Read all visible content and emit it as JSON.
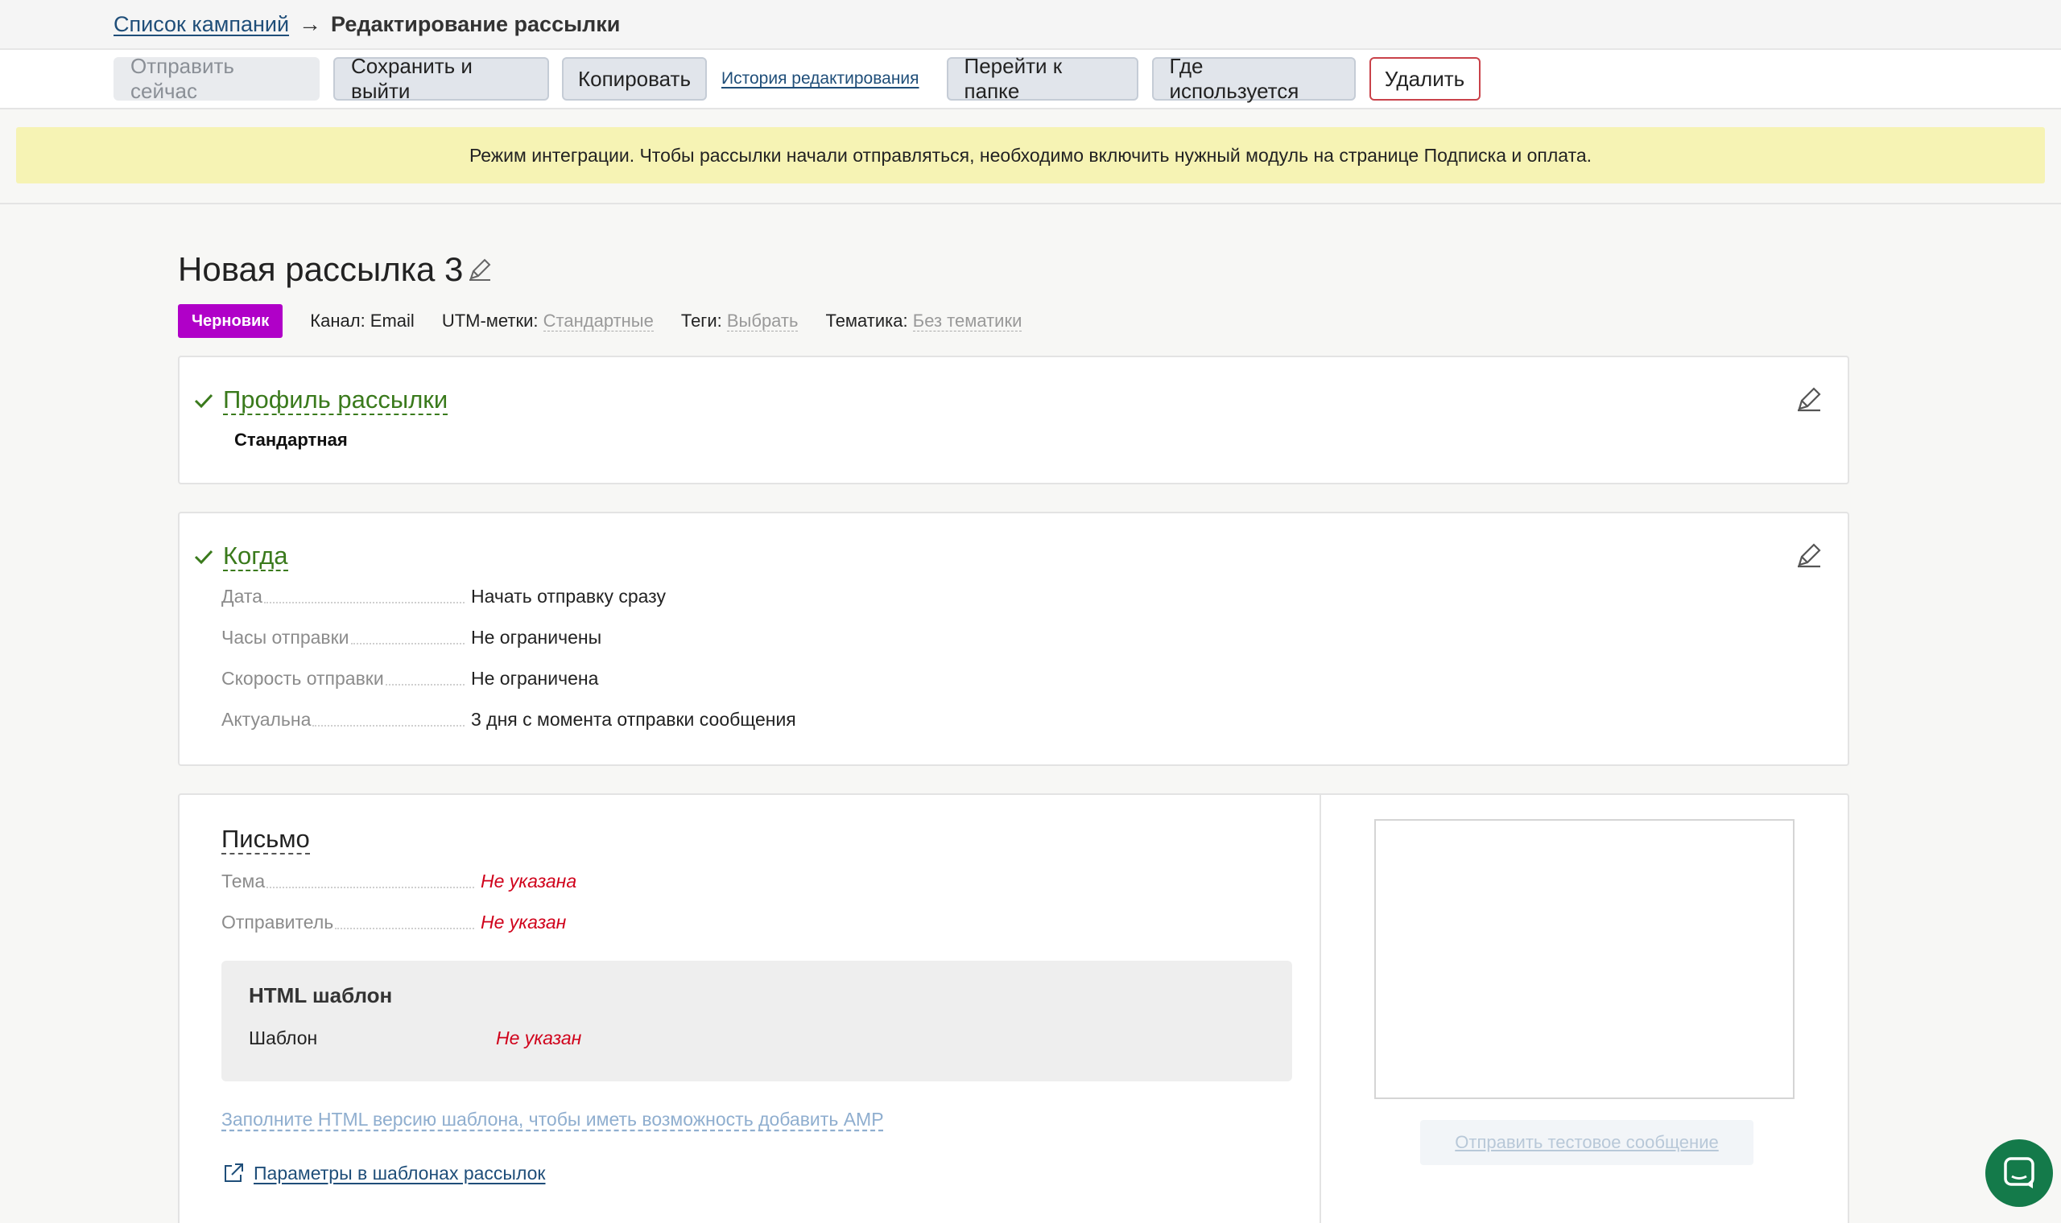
{
  "breadcrumb": {
    "parent": "Список кампаний",
    "arrow": "→",
    "current": "Редактирование рассылки"
  },
  "toolbar": {
    "send_now": "Отправить сейчас",
    "save_exit": "Сохранить и выйти",
    "copy": "Копировать",
    "history": "История редактирования",
    "go_folder": "Перейти к папке",
    "where_used": "Где используется",
    "delete": "Удалить"
  },
  "notice": "Режим интеграции. Чтобы рассылки начали отправляться, необходимо включить нужный модуль на странице Подписка и оплата.",
  "campaign": {
    "title": "Новая рассылка 3",
    "status": "Черновик",
    "channel_label": "Канал: Email",
    "utm_label": "UTM-метки:",
    "utm_value": "Стандартные",
    "tags_label": "Теги:",
    "tags_value": "Выбрать",
    "topic_label": "Тематика:",
    "topic_value": "Без тематики"
  },
  "profile_card": {
    "title": "Профиль рассылки",
    "value": "Стандартная"
  },
  "when_card": {
    "title": "Когда",
    "rows": [
      {
        "k": "Дата",
        "v": "Начать отправку сразу"
      },
      {
        "k": "Часы отправки",
        "v": "Не ограничены"
      },
      {
        "k": "Скорость отправки",
        "v": "Не ограничена"
      },
      {
        "k": "Актуальна",
        "v": "3 дня с момента отправки сообщения"
      }
    ]
  },
  "letter_card": {
    "title": "Письмо",
    "rows": [
      {
        "k": "Тема",
        "v": "Не указана"
      },
      {
        "k": "Отправитель",
        "v": "Не указан"
      }
    ],
    "html_box_title": "HTML шаблон",
    "template_label": "Шаблон",
    "template_value": "Не указан",
    "amp_link": "Заполните HTML версию шаблона, чтобы иметь возможность добавить AMP",
    "params_link": "Параметры в шаблонах рассылок",
    "test_button": "Отправить тестовое сообщение"
  },
  "colors": {
    "badge": "#b000c8",
    "success": "#3a7a1c",
    "error": "#d0021b",
    "notice": "#f6f3b4",
    "chat": "#147a4a"
  }
}
